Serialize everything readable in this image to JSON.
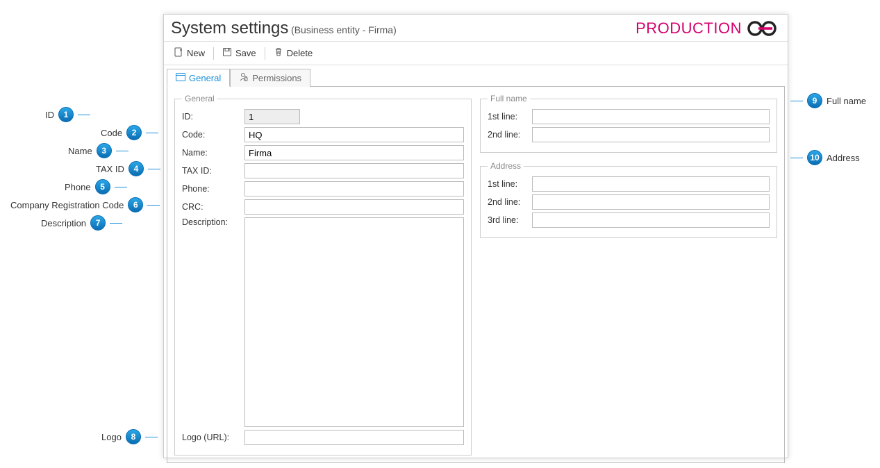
{
  "header": {
    "title": "System settings",
    "subtitle": "(Business entity - Firma)",
    "brand": "PRODUCTION"
  },
  "toolbar": {
    "new_label": "New",
    "save_label": "Save",
    "delete_label": "Delete"
  },
  "tabs": {
    "general": "General",
    "permissions": "Permissions"
  },
  "form": {
    "general": {
      "legend": "General",
      "id_label": "ID:",
      "id_value": "1",
      "code_label": "Code:",
      "code_value": "HQ",
      "name_label": "Name:",
      "name_value": "Firma",
      "taxid_label": "TAX ID:",
      "taxid_value": "",
      "phone_label": "Phone:",
      "phone_value": "",
      "crc_label": "CRC:",
      "crc_value": "",
      "desc_label": "Description:",
      "desc_value": "",
      "logo_label": "Logo (URL):",
      "logo_value": ""
    },
    "fullname": {
      "legend": "Full name",
      "line1_label": "1st line:",
      "line1_value": "",
      "line2_label": "2nd line:",
      "line2_value": ""
    },
    "address": {
      "legend": "Address",
      "line1_label": "1st line:",
      "line1_value": "",
      "line2_label": "2nd line:",
      "line2_value": "",
      "line3_label": "3rd line:",
      "line3_value": ""
    }
  },
  "callouts": {
    "c1": "ID",
    "c2": "Code",
    "c3": "Name",
    "c4": "TAX ID",
    "c5": "Phone",
    "c6": "Company Registration Code",
    "c7": "Description",
    "c8": "Logo",
    "c9": "Full name",
    "c10": "Address"
  }
}
